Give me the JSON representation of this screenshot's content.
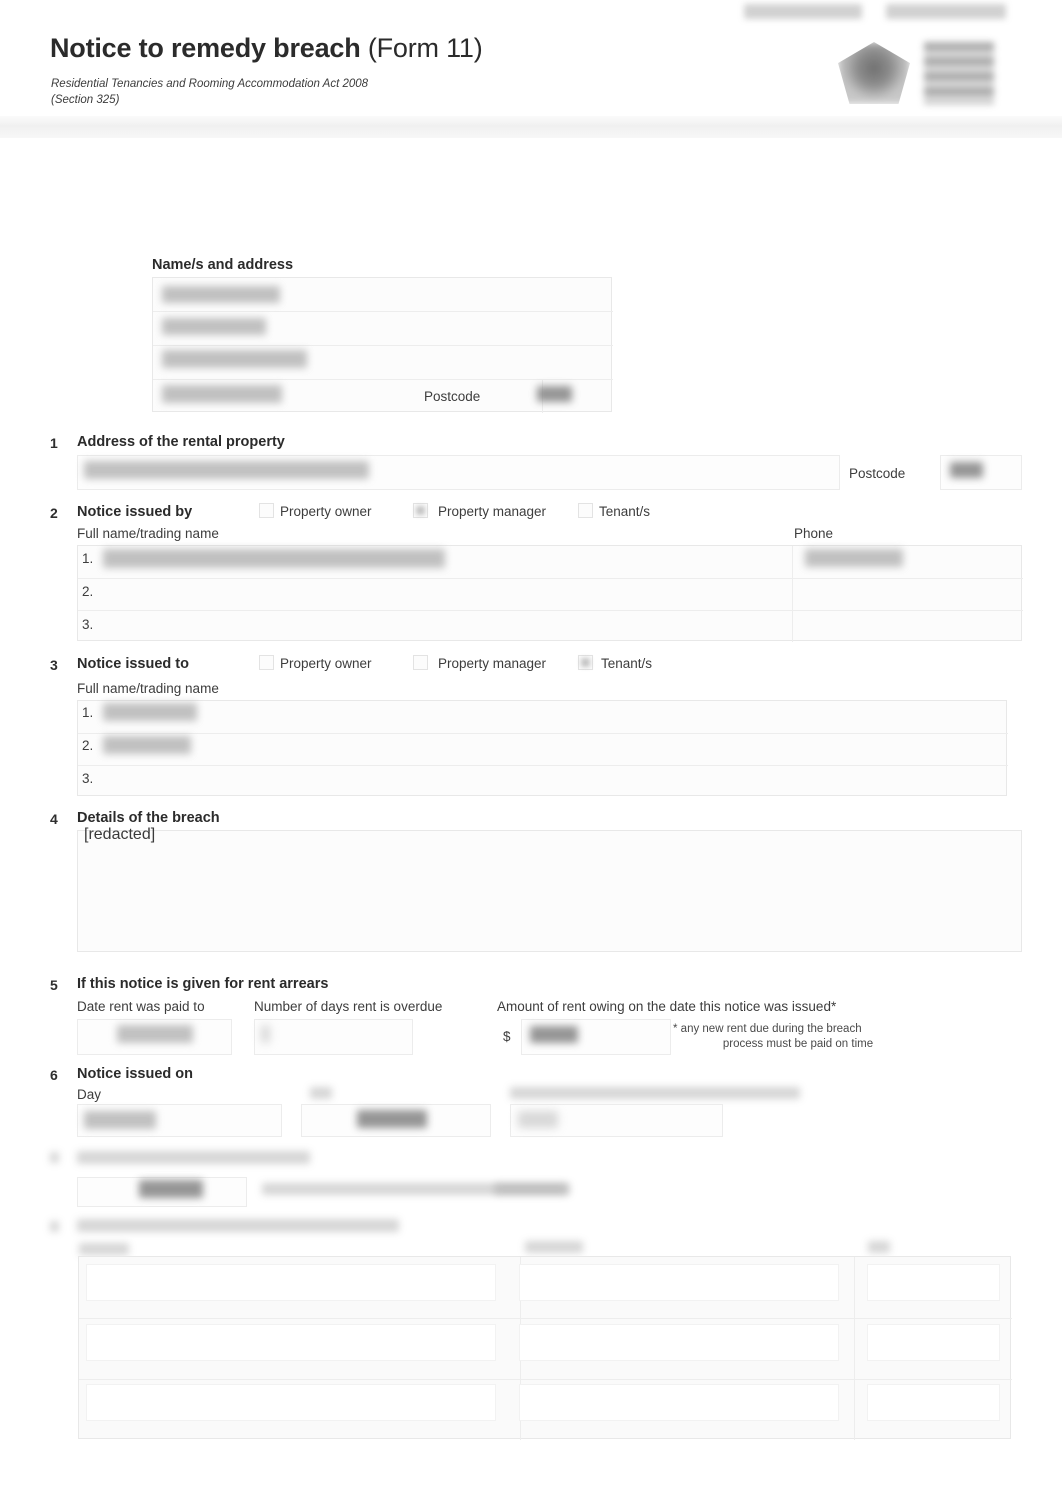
{
  "document": {
    "title_bold": "Notice to remedy breach",
    "title_light": "(Form 11)",
    "act_line": "Residential Tenancies and Rooming Accommodation Act 2008",
    "section_line": "(Section 325)",
    "logo": {
      "name": "queensland-government-crest",
      "wordmark_left": "[redacted]",
      "wordmark_right": "[redacted]"
    }
  },
  "recipient_block": {
    "heading": "Name/s and address",
    "lines": [
      {
        "value": "[redacted]"
      },
      {
        "value": "[redacted]"
      },
      {
        "value": "[redacted]"
      },
      {
        "value": "[redacted]"
      }
    ],
    "postcode_label": "Postcode",
    "postcode_value": "[redacted]"
  },
  "sections": [
    {
      "number": "1",
      "title": "Address of the rental property",
      "address_value": "[redacted]",
      "postcode_label": "Postcode",
      "postcode_value": "[redacted]"
    },
    {
      "number": "2",
      "title": "Notice issued by",
      "options": [
        {
          "label": "Property owner",
          "checked": false
        },
        {
          "label": "Property manager",
          "checked": true
        },
        {
          "label": "Tenant/s",
          "checked": false
        }
      ],
      "col_name_label": "Full name/trading name",
      "col_phone_label": "Phone",
      "rows": [
        {
          "index": "1.",
          "name": "[redacted]",
          "phone": "[redacted]"
        },
        {
          "index": "2.",
          "name": "",
          "phone": ""
        },
        {
          "index": "3.",
          "name": "",
          "phone": ""
        }
      ]
    },
    {
      "number": "3",
      "title": "Notice issued to",
      "options": [
        {
          "label": "Property owner",
          "checked": false
        },
        {
          "label": "Property manager",
          "checked": false
        },
        {
          "label": "Tenant/s",
          "checked": true
        }
      ],
      "col_name_label": "Full name/trading name",
      "rows": [
        {
          "index": "1.",
          "name": "[redacted]"
        },
        {
          "index": "2.",
          "name": "[redacted]"
        },
        {
          "index": "3.",
          "name": ""
        }
      ]
    },
    {
      "number": "4",
      "title": "Details of the breach",
      "body_value": "[redacted]"
    },
    {
      "number": "5",
      "title": "If this notice is given for rent arrears",
      "date_paid_label": "Date rent was paid to",
      "date_paid_value": "[redacted]",
      "days_overdue_label": "Number of days rent is overdue",
      "days_overdue_value": "[redacted]",
      "amount_label": "Amount of rent owing on the date this notice was issued*",
      "currency_symbol": "$",
      "amount_value": "[redacted]",
      "footnote_line1": "* any new rent due during the breach",
      "footnote_line2": "process must be paid on time"
    },
    {
      "number": "6",
      "title": "Notice issued on",
      "day_label": "Day",
      "day_value": "[redacted]",
      "date_label": "[redacted]",
      "date_value": "[redacted]",
      "method_label": "[redacted]",
      "method_value": "[redacted]"
    },
    {
      "number": "7",
      "title": "[redacted]",
      "value_a": "[redacted]",
      "value_b": "[redacted]",
      "trailing_text": "[redacted]"
    },
    {
      "number": "8",
      "title": "[redacted]",
      "col_name_label": "[redacted]",
      "col_signature_label": "[redacted]",
      "col_date_label": "[redacted]",
      "rows": [
        {
          "name": "",
          "signature": "",
          "date": ""
        },
        {
          "name": "",
          "signature": "",
          "date": ""
        },
        {
          "name": "",
          "signature": "",
          "date": ""
        }
      ]
    }
  ]
}
